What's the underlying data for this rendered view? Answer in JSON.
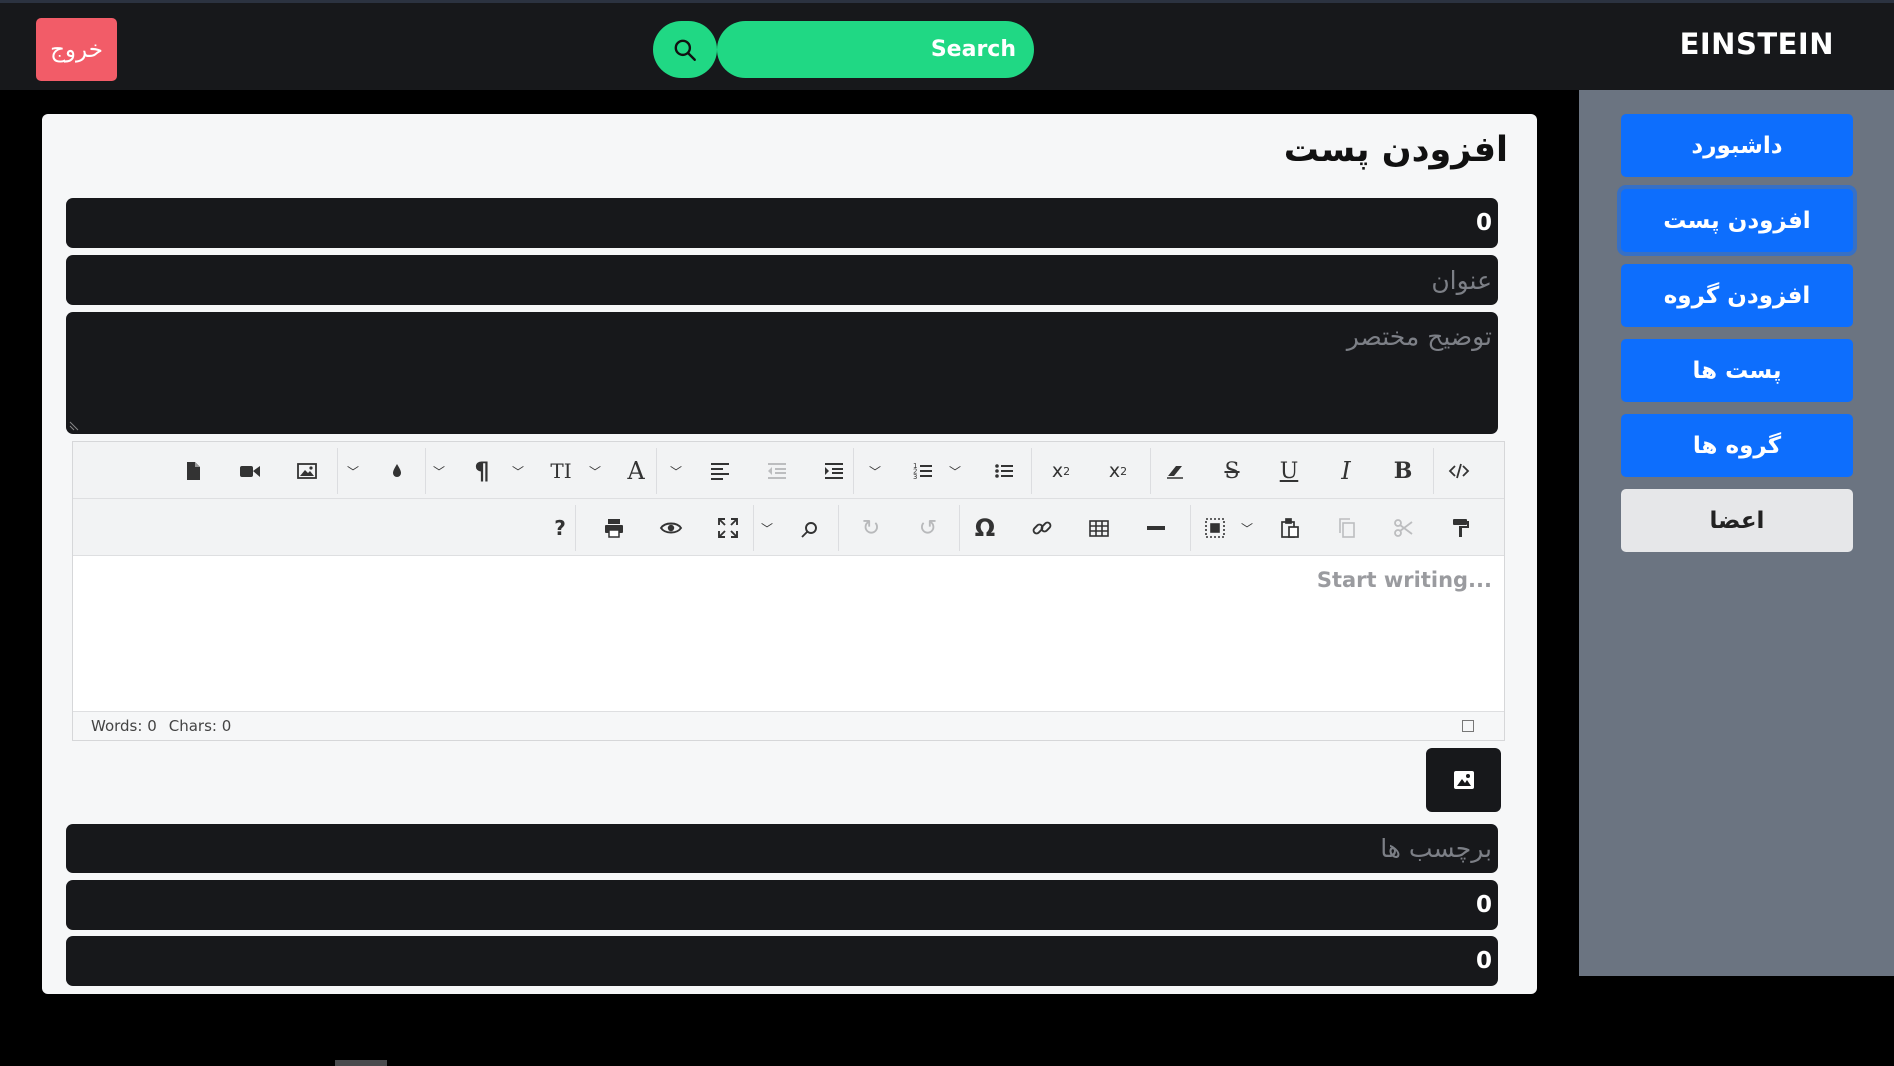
{
  "header": {
    "brand": "EINSTEIN",
    "logout_label": "خروج",
    "search_placeholder": "Search"
  },
  "sidebar": {
    "items": [
      {
        "label": "داشبورد"
      },
      {
        "label": "افزودن پست"
      },
      {
        "label": "افزودن گروه"
      },
      {
        "label": "پست ها"
      },
      {
        "label": "گروه ها"
      },
      {
        "label": "اعضا"
      }
    ]
  },
  "main": {
    "title": "افزودن پست",
    "fields": {
      "number_top_value": "0",
      "title_placeholder": "عنوان",
      "summary_placeholder": "توضیح مختصر",
      "tags_placeholder": "برچسب ها",
      "number_bottom_1_value": "0",
      "number_bottom_2_value": "0"
    },
    "editor": {
      "placeholder": "Start writing...",
      "words_label": "Words: 0",
      "chars_label": "Chars: 0",
      "toolbar_row1": [
        "source-code-icon",
        "bold-icon",
        "italic-icon",
        "underline-icon",
        "strikethrough-icon",
        "eraser-icon",
        "superscript-icon",
        "subscript-icon",
        "unordered-list-icon",
        "ordered-list-icon",
        "indent-icon",
        "outdent-icon",
        "align-left-icon",
        "font-icon",
        "font-size-icon",
        "paragraph-icon",
        "color-drop-icon",
        "image-icon",
        "video-icon",
        "file-icon"
      ],
      "toolbar_row2": [
        "format-painter-icon",
        "cut-icon",
        "copy-icon",
        "paste-icon",
        "select-all-icon",
        "horizontal-rule-icon",
        "table-icon",
        "link-icon",
        "special-char-icon",
        "undo-icon",
        "redo-icon",
        "find-icon",
        "fullscreen-icon",
        "preview-icon",
        "print-icon",
        "help-icon"
      ]
    }
  },
  "colors": {
    "accent_green": "#20d884",
    "primary_blue": "#0d6efd",
    "danger": "#f25c68",
    "dark": "#17181b",
    "sidebar_bg": "#6b7481"
  }
}
